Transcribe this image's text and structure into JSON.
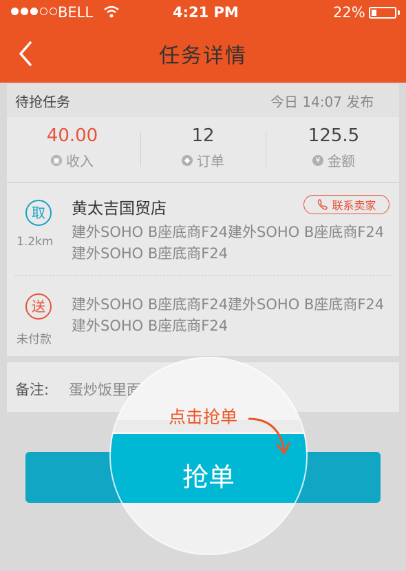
{
  "status_bar": {
    "carrier": "BELL",
    "time": "4:21 PM",
    "battery": "22%"
  },
  "header": {
    "title": "任务详情"
  },
  "task": {
    "type": "待抢任务",
    "published": "今日  14:07 发布"
  },
  "stats": [
    {
      "value": "40.00",
      "label": "收入",
      "icon": "wallet-icon"
    },
    {
      "value": "12",
      "label": "订单",
      "icon": "tag-icon"
    },
    {
      "value": "125.5",
      "label": "金额",
      "icon": "yen-icon"
    }
  ],
  "pickup": {
    "badge": "取",
    "distance": "1.2km",
    "shop": "黄太吉国贸店",
    "contact_label": "联系卖家",
    "address": "建外SOHO B座底商F24建外SOHO B座底商F24建外SOHO B座底商F24"
  },
  "delivery": {
    "badge": "送",
    "payment": "未付款",
    "address": "建外SOHO B座底商F24建外SOHO B座底商F24建外SOHO B座底商F24"
  },
  "note": {
    "label": "备注:",
    "text": "蛋炒饭里面"
  },
  "action": {
    "grab_label": "抢单",
    "hint": "点击抢单"
  },
  "colors": {
    "brand": "#eb5524",
    "accent": "#00b7d4",
    "highlight": "#e8533a"
  }
}
